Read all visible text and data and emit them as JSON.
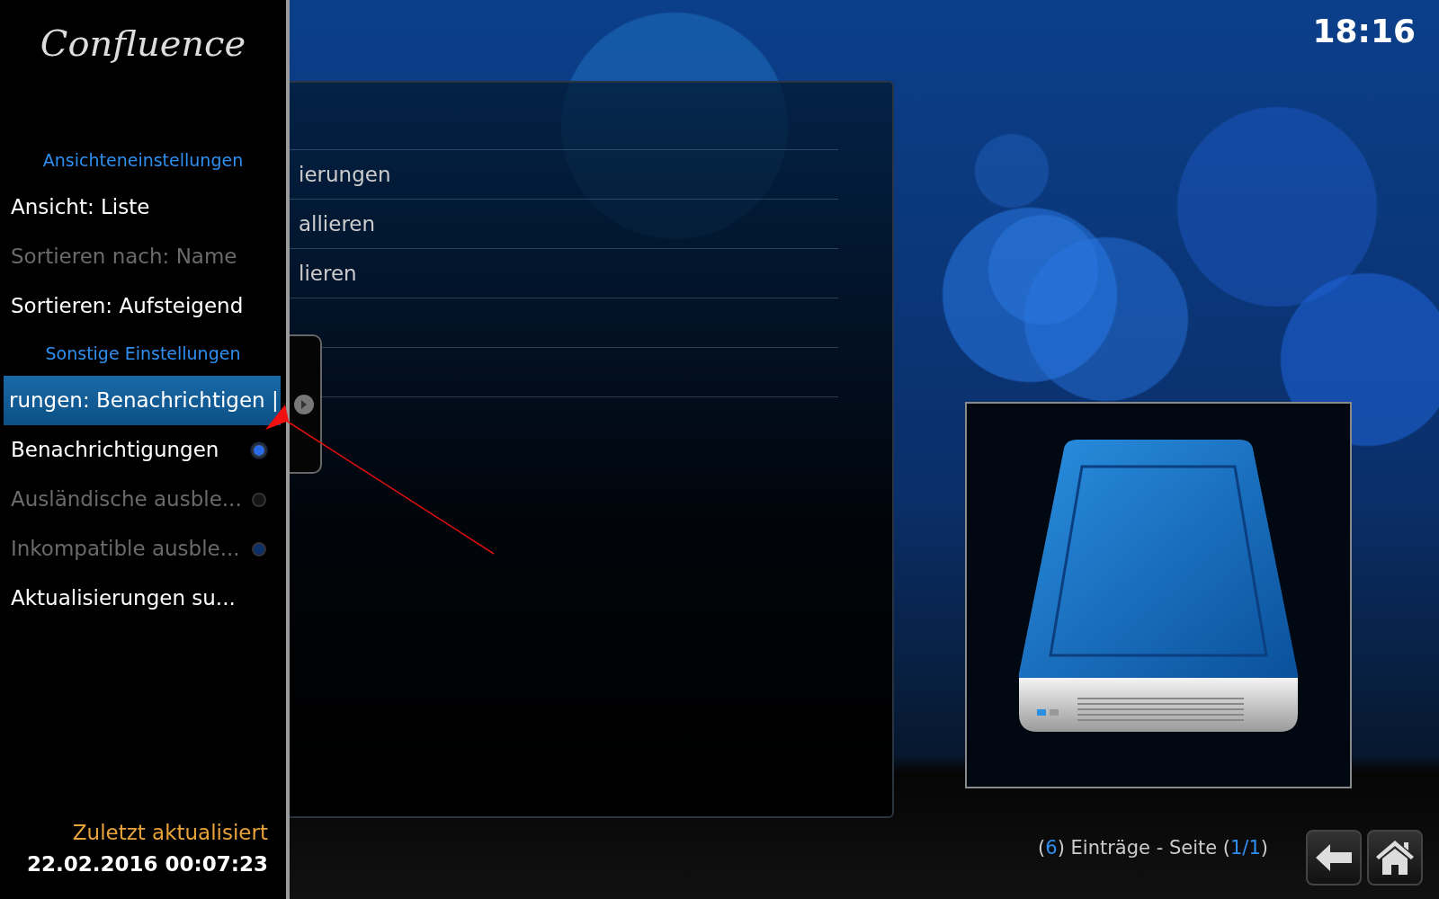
{
  "logo": "Confluence",
  "clock": "18:16",
  "sidebar": {
    "items": [
      {
        "kind": "header",
        "label": "Ansichteneinstellungen"
      },
      {
        "kind": "button",
        "label": "Ansicht: Liste",
        "disabled": false,
        "selected": false
      },
      {
        "kind": "button",
        "label": "Sortieren nach: Name",
        "disabled": true,
        "selected": false
      },
      {
        "kind": "button",
        "label": "Sortieren: Aufsteigend",
        "disabled": false,
        "selected": false
      },
      {
        "kind": "header",
        "label": "Sonstige Einstellungen"
      },
      {
        "kind": "button",
        "label": "rungen: Benachrichtigen |",
        "disabled": false,
        "selected": true
      },
      {
        "kind": "toggle",
        "label": "Benachrichtigungen",
        "disabled": false,
        "selected": false,
        "on": true
      },
      {
        "kind": "toggle",
        "label": "Ausländische ausble...",
        "disabled": true,
        "selected": false,
        "on": false
      },
      {
        "kind": "toggle",
        "label": "Inkompatible ausble...",
        "disabled": true,
        "selected": false,
        "on": true
      },
      {
        "kind": "button",
        "label": "Aktualisierungen su...",
        "disabled": false,
        "selected": false
      }
    ],
    "footer": {
      "caption": "Zuletzt aktualisiert",
      "value": "22.02.2016 00:07:23"
    }
  },
  "list": {
    "items": [
      {
        "label": "ierungen"
      },
      {
        "label": "allieren"
      },
      {
        "label": "lieren"
      }
    ]
  },
  "status": {
    "parts": [
      {
        "text": "(",
        "accent": false
      },
      {
        "text": "6",
        "accent": true
      },
      {
        "text": ") Einträge - Seite (",
        "accent": false
      },
      {
        "text": "1/1",
        "accent": true
      },
      {
        "text": ")",
        "accent": false
      }
    ]
  }
}
